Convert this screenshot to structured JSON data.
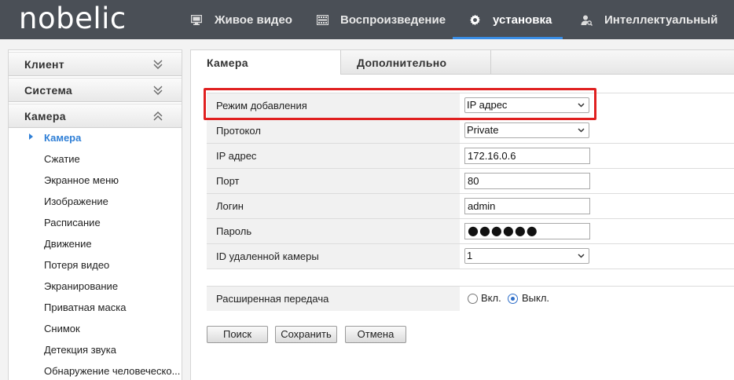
{
  "header": {
    "logo": "nobelic",
    "nav": [
      {
        "label": "Живое видео",
        "icon": "monitor-icon"
      },
      {
        "label": "Воспроизведение",
        "icon": "film-icon"
      },
      {
        "label": "установка",
        "icon": "gear-icon",
        "active": true
      },
      {
        "label": "Интеллектуальный",
        "icon": "person-search-icon"
      }
    ]
  },
  "sidebar": {
    "sections": [
      {
        "label": "Клиент",
        "state": "collapsed"
      },
      {
        "label": "Система",
        "state": "collapsed"
      },
      {
        "label": "Камера",
        "state": "expanded"
      }
    ],
    "items": [
      {
        "label": "Камера",
        "active": true
      },
      {
        "label": "Сжатие"
      },
      {
        "label": "Экранное меню"
      },
      {
        "label": "Изображение"
      },
      {
        "label": "Расписание"
      },
      {
        "label": "Движение"
      },
      {
        "label": "Потеря видео"
      },
      {
        "label": "Экранирование"
      },
      {
        "label": "Приватная маска"
      },
      {
        "label": "Снимок"
      },
      {
        "label": "Детекция звука"
      },
      {
        "label": "Обнаружение человеческо..."
      }
    ]
  },
  "tabs": [
    {
      "label": "Камера",
      "active": true
    },
    {
      "label": "Дополнительно"
    }
  ],
  "form": {
    "add_mode": {
      "label": "Режим добавления",
      "value": "IP адрес"
    },
    "protocol": {
      "label": "Протокол",
      "value": "Private"
    },
    "ip": {
      "label": "IP адрес",
      "value": "172.16.0.6"
    },
    "port": {
      "label": "Порт",
      "value": "80"
    },
    "login": {
      "label": "Логин",
      "value": "admin"
    },
    "password": {
      "label": "Пароль",
      "value": "●●●●●●"
    },
    "remote_id": {
      "label": "ID удаленной камеры",
      "value": "1"
    },
    "extended": {
      "label": "Расширенная передача",
      "on_label": "Вкл.",
      "off_label": "Выкл.",
      "selected": "off"
    }
  },
  "buttons": {
    "search": "Поиск",
    "save": "Сохранить",
    "cancel": "Отмена"
  },
  "colors": {
    "header_bg": "#4a4f56",
    "accent": "#2f7fd6",
    "highlight": "#e02020"
  }
}
